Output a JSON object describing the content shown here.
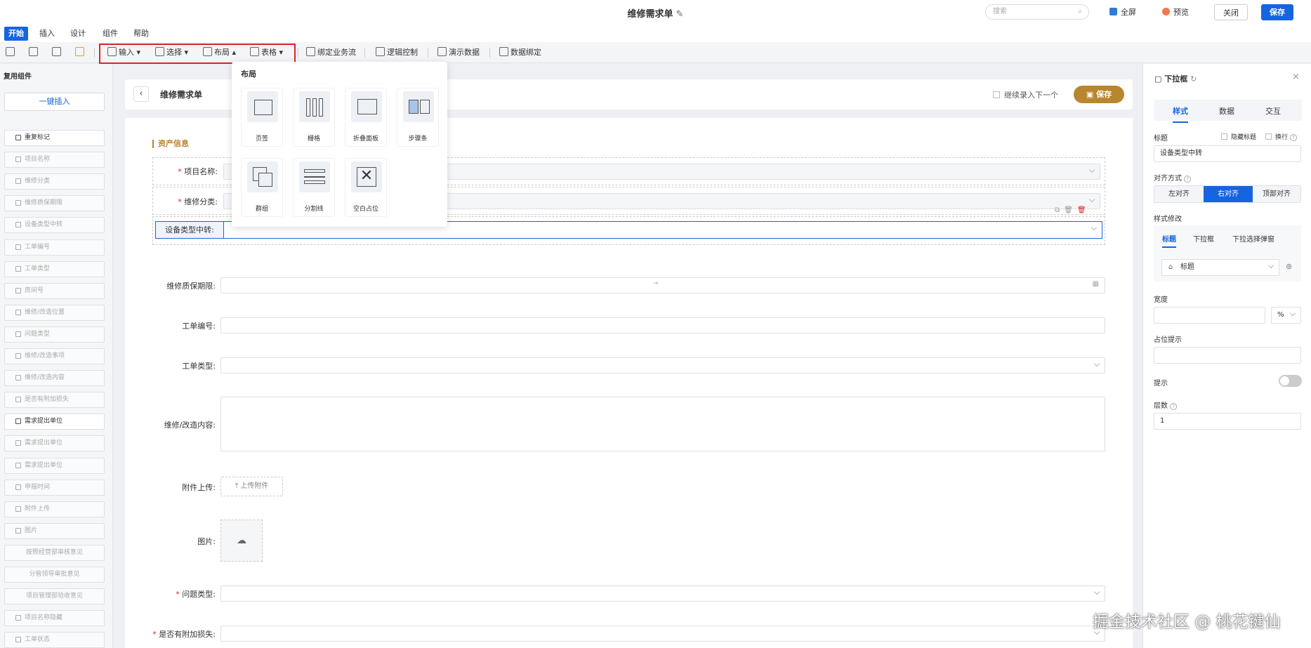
{
  "header": {
    "title": "维修需求单",
    "search_placeholder": "搜索",
    "fullscreen": "全屏",
    "preview": "预览",
    "close": "关闭",
    "save": "保存"
  },
  "menu": {
    "items": [
      "开始",
      "插入",
      "设计",
      "组件",
      "帮助"
    ]
  },
  "toolbar": {
    "input": "输入",
    "select": "选择",
    "layout": "布局",
    "table": "表格",
    "bind_flow": "绑定业务流",
    "logic": "逻辑控制",
    "demo": "演示数据",
    "data_bind": "数据绑定"
  },
  "left_panel": {
    "title": "复用组件",
    "insert_btn": "一键插入",
    "items": [
      "重复标记",
      "项目名称",
      "维修分类",
      "维修质保期限",
      "设备类型中转",
      "工单编号",
      "工单类型",
      "房间号",
      "维修/改造位置",
      "问题类型",
      "维修/改造事项",
      "维修/改造内容",
      "是否有附加损失",
      "需求提出单位",
      "需求提出单位",
      "需求提出单位",
      "申报时间",
      "附件上传",
      "图片",
      "按照经营部审核意见",
      "分管领导审批意见",
      "项目管理部验收意见",
      "项目名称隐藏",
      "工单状态"
    ]
  },
  "form": {
    "title": "维修需求单",
    "continue": "继续录入下一个",
    "save": "保存",
    "section": "资产信息",
    "fields": {
      "project": "项目名称:",
      "category": "维修分类:",
      "device": "设备类型中转:",
      "warranty": "维修质保期限:",
      "ticket_no": "工单编号:",
      "ticket_type": "工单类型:",
      "content": "维修/改造内容:",
      "attachment": "附件上传:",
      "image": "图片:",
      "issue": "问题类型:",
      "extra_loss": "是否有附加损失:"
    },
    "upload_btn": "上传附件",
    "warranty_arrow": "→"
  },
  "layout_dropdown": {
    "title": "布局",
    "items": [
      "页签",
      "栅格",
      "折叠面板",
      "步骤条",
      "群组",
      "分割线",
      "空白占位"
    ]
  },
  "right_panel": {
    "title": "下拉框",
    "tabs": [
      "样式",
      "数据",
      "交互"
    ],
    "title_label": "标题",
    "hide_title": "隐藏标题",
    "wrap": "换行",
    "title_value": "设备类型中转",
    "align_label": "对齐方式",
    "align_opts": [
      "左对齐",
      "右对齐",
      "顶部对齐"
    ],
    "style_label": "样式修改",
    "style_tabs": [
      "标题",
      "下拉框",
      "下拉选择弹窗"
    ],
    "style_select": "标题",
    "width_label": "宽度",
    "width_unit": "%",
    "placeholder_label": "占位提示",
    "tip_label": "提示",
    "levels_label": "层数",
    "levels_value": "1"
  },
  "watermark": "掘金技术社区 @ 桃花键仙",
  "colors": {
    "primary": "#1565e0",
    "gold": "#b8862e",
    "highlight": "#e02222"
  }
}
